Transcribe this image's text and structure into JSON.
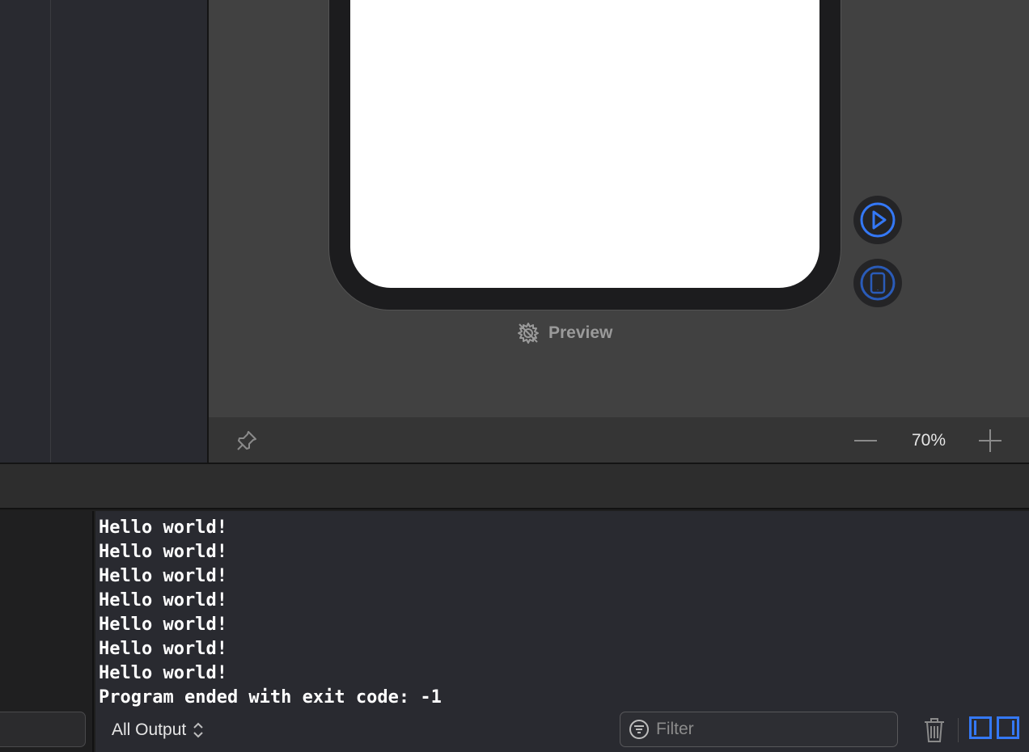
{
  "canvas": {
    "preview_label": "Preview",
    "play_icon": "play-circle-icon",
    "device_icon": "device-settings-icon",
    "preview_icon": "preview-disabled-gear-icon"
  },
  "canvas_toolbar": {
    "pin_icon": "pin-icon",
    "zoom_out_icon": "minus-icon",
    "zoom_level": "70%",
    "zoom_in_icon": "plus-icon"
  },
  "console": {
    "lines": [
      "Hello world!",
      "Hello world!",
      "Hello world!",
      "Hello world!",
      "Hello world!",
      "Hello world!",
      "Hello world!",
      "Program ended with exit code: -1"
    ],
    "output_selector": "All Output",
    "filter_placeholder": "Filter",
    "trash_icon": "trash-icon",
    "accent_color": "#3478f6"
  }
}
